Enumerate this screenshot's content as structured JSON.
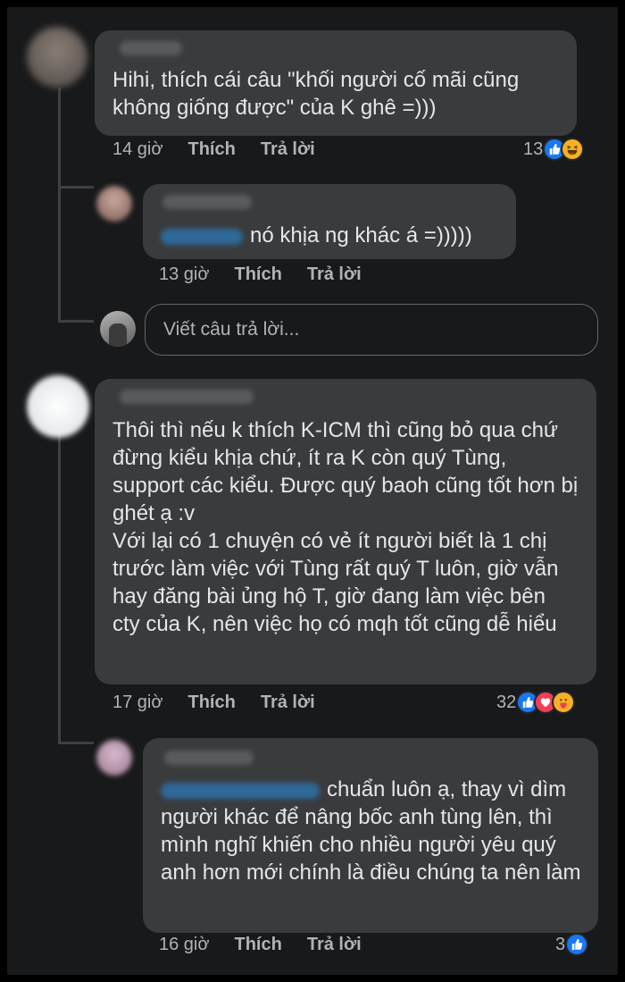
{
  "thread": {
    "comment1": {
      "text": "Hihi, thích cái câu \"khối người cố mãi cũng không giống được\" của K ghê =)))",
      "time": "14 giờ",
      "like_label": "Thích",
      "reply_label": "Trả lời",
      "reaction_count": "13",
      "reactions": [
        "like-icon",
        "haha-icon"
      ]
    },
    "reply1": {
      "text": "nó khịa ng khác á =)))))",
      "time": "13 giờ",
      "like_label": "Thích",
      "reply_label": "Trả lời"
    },
    "reply_box": {
      "placeholder": "Viết câu trả lời..."
    },
    "comment2": {
      "text": "Thôi thì nếu k thích K-ICM thì cũng bỏ qua chứ đừng kiểu khịa chứ, ít ra K còn quý Tùng, support các kiểu. Được quý baoh cũng tốt hơn bị ghét ạ :v\nVới lại có 1 chuyện có vẻ ít người biết là 1 chị trước làm việc với Tùng rất quý T luôn, giờ vẫn hay đăng bài ủng hộ T, giờ đang làm việc bên cty của K, nên việc họ có mqh tốt cũng dễ hiểu",
      "time": "17 giờ",
      "like_label": "Thích",
      "reply_label": "Trả lời",
      "reaction_count": "32",
      "reactions": [
        "like-icon",
        "love-icon",
        "care-icon"
      ]
    },
    "reply2": {
      "text": "chuẩn luôn ạ, thay vì dìm người khác để nâng bốc anh tùng lên, thì mình nghĩ khiến cho nhiều người yêu quý anh hơn mới chính là điều chúng ta nên làm",
      "time": "16 giờ",
      "like_label": "Thích",
      "reply_label": "Trả lời",
      "reaction_count": "3",
      "reactions": [
        "like-icon"
      ]
    }
  },
  "colors": {
    "background": "#18191a",
    "bubble": "#3a3b3c",
    "text": "#e4e6eb",
    "meta": "#b0b3b8",
    "like_blue": "#1877f2",
    "love_red": "#f33e58",
    "haha_yellow": "#f7b125"
  }
}
